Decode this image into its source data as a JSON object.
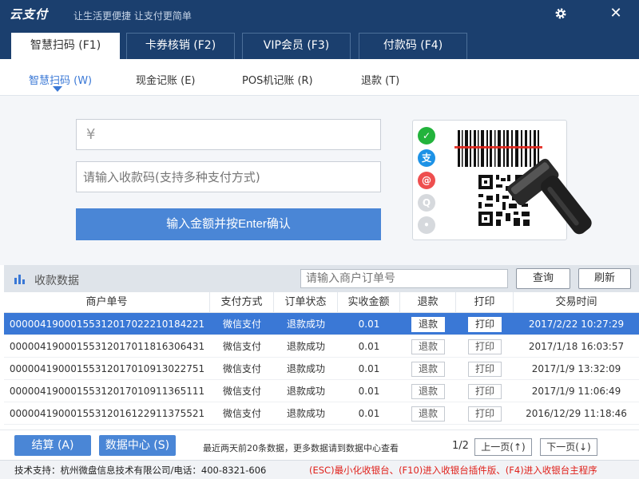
{
  "app": {
    "logo_text": "云支付",
    "slogan": "让生活更便捷 让支付更简单"
  },
  "main_tabs": [
    {
      "label": "智慧扫码 (F1)",
      "active": true
    },
    {
      "label": "卡券核销 (F2)",
      "active": false
    },
    {
      "label": "VIP会员 (F3)",
      "active": false
    },
    {
      "label": "付款码 (F4)",
      "active": false
    }
  ],
  "sub_tabs": [
    {
      "label": "智慧扫码 (W)",
      "active": true
    },
    {
      "label": "现金记账 (E)",
      "active": false
    },
    {
      "label": "POS机记账 (R)",
      "active": false
    },
    {
      "label": "退款 (T)",
      "active": false
    }
  ],
  "payment": {
    "currency_symbol": "¥",
    "amount_value": "",
    "code_placeholder": "请输入收款码(支持多种支付方式)",
    "confirm_label": "输入金额并按Enter确认",
    "icons": [
      "wechat-pay-icon",
      "alipay-icon",
      "union-icon",
      "qq-wallet-icon",
      "other-pay-icon"
    ]
  },
  "data_section": {
    "title": "收款数据",
    "search_placeholder": "请输入商户订单号",
    "query_label": "查询",
    "refresh_label": "刷新"
  },
  "table": {
    "headers": [
      "商户单号",
      "支付方式",
      "订单状态",
      "实收金额",
      "退款",
      "打印",
      "交易时间"
    ],
    "refund_label": "退款",
    "print_label": "打印",
    "rows": [
      {
        "order_no": "000004190001553120170222101842​21",
        "method": "微信支付",
        "status": "退款成功",
        "amount": "0.01",
        "time": "2017/2/22 10:27:29",
        "selected": true
      },
      {
        "order_no": "00000419000155312017011816306431",
        "method": "微信支付",
        "status": "退款成功",
        "amount": "0.01",
        "time": "2017/1/18 16:03:57",
        "selected": false
      },
      {
        "order_no": "00000419000155312017010913022751",
        "method": "微信支付",
        "status": "退款成功",
        "amount": "0.01",
        "time": "2017/1/9 13:32:09",
        "selected": false
      },
      {
        "order_no": "00000419000155312017010911365111",
        "method": "微信支付",
        "status": "退款成功",
        "amount": "0.01",
        "time": "2017/1/9 11:06:49",
        "selected": false
      },
      {
        "order_no": "00000419000155312016122911375521",
        "method": "微信支付",
        "status": "退款成功",
        "amount": "0.01",
        "time": "2016/12/29 11:18:46",
        "selected": false
      }
    ]
  },
  "bottom": {
    "settle_label": "结算 (A)",
    "datacenter_label": "数据中心 (S)",
    "notice": "最近两天前20条数据，更多数据请到数据中心查看",
    "page_indicator": "1/2",
    "prev_label": "上一页(↑)",
    "next_label": "下一页(↓)"
  },
  "footer": {
    "support": "技术支持：杭州微盘信息技术有限公司/电话：400-8321-606",
    "hotkeys": "(ESC)最小化收银台、(F10)进入收银台插件版、(F4)进入收银台主程序"
  },
  "colors": {
    "titlebar": "#1b3f6e",
    "accent": "#4a86d6",
    "selected_row": "#3a78d6",
    "hotkey_text": "#e0211b"
  }
}
